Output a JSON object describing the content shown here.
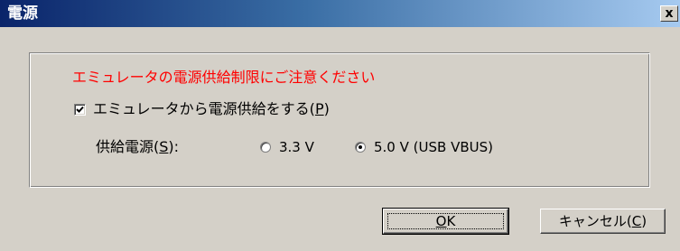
{
  "window": {
    "title": "電源",
    "close_glyph": "x"
  },
  "group": {
    "warning_text": "エミュレータの電源供給制限にご注意ください",
    "warning_color": "#ff0000",
    "checkbox": {
      "label_main": "エミュレータから電源供給をする(",
      "accel": "P",
      "label_end": ")",
      "checked": true
    },
    "supply": {
      "label_main": "供給電源(",
      "accel": "S",
      "label_end": "):",
      "options": [
        {
          "label": "3.3 V",
          "selected": false
        },
        {
          "label": "5.0 V (USB VBUS)",
          "selected": true
        }
      ]
    }
  },
  "buttons": {
    "ok": {
      "accel": "O",
      "rest": "K"
    },
    "cancel": {
      "label_main": "キャンセル(",
      "accel": "C",
      "label_end": ")"
    }
  },
  "colors": {
    "face": "#d4d0c8",
    "title_start": "#0a246a",
    "title_end": "#a6caf0"
  }
}
